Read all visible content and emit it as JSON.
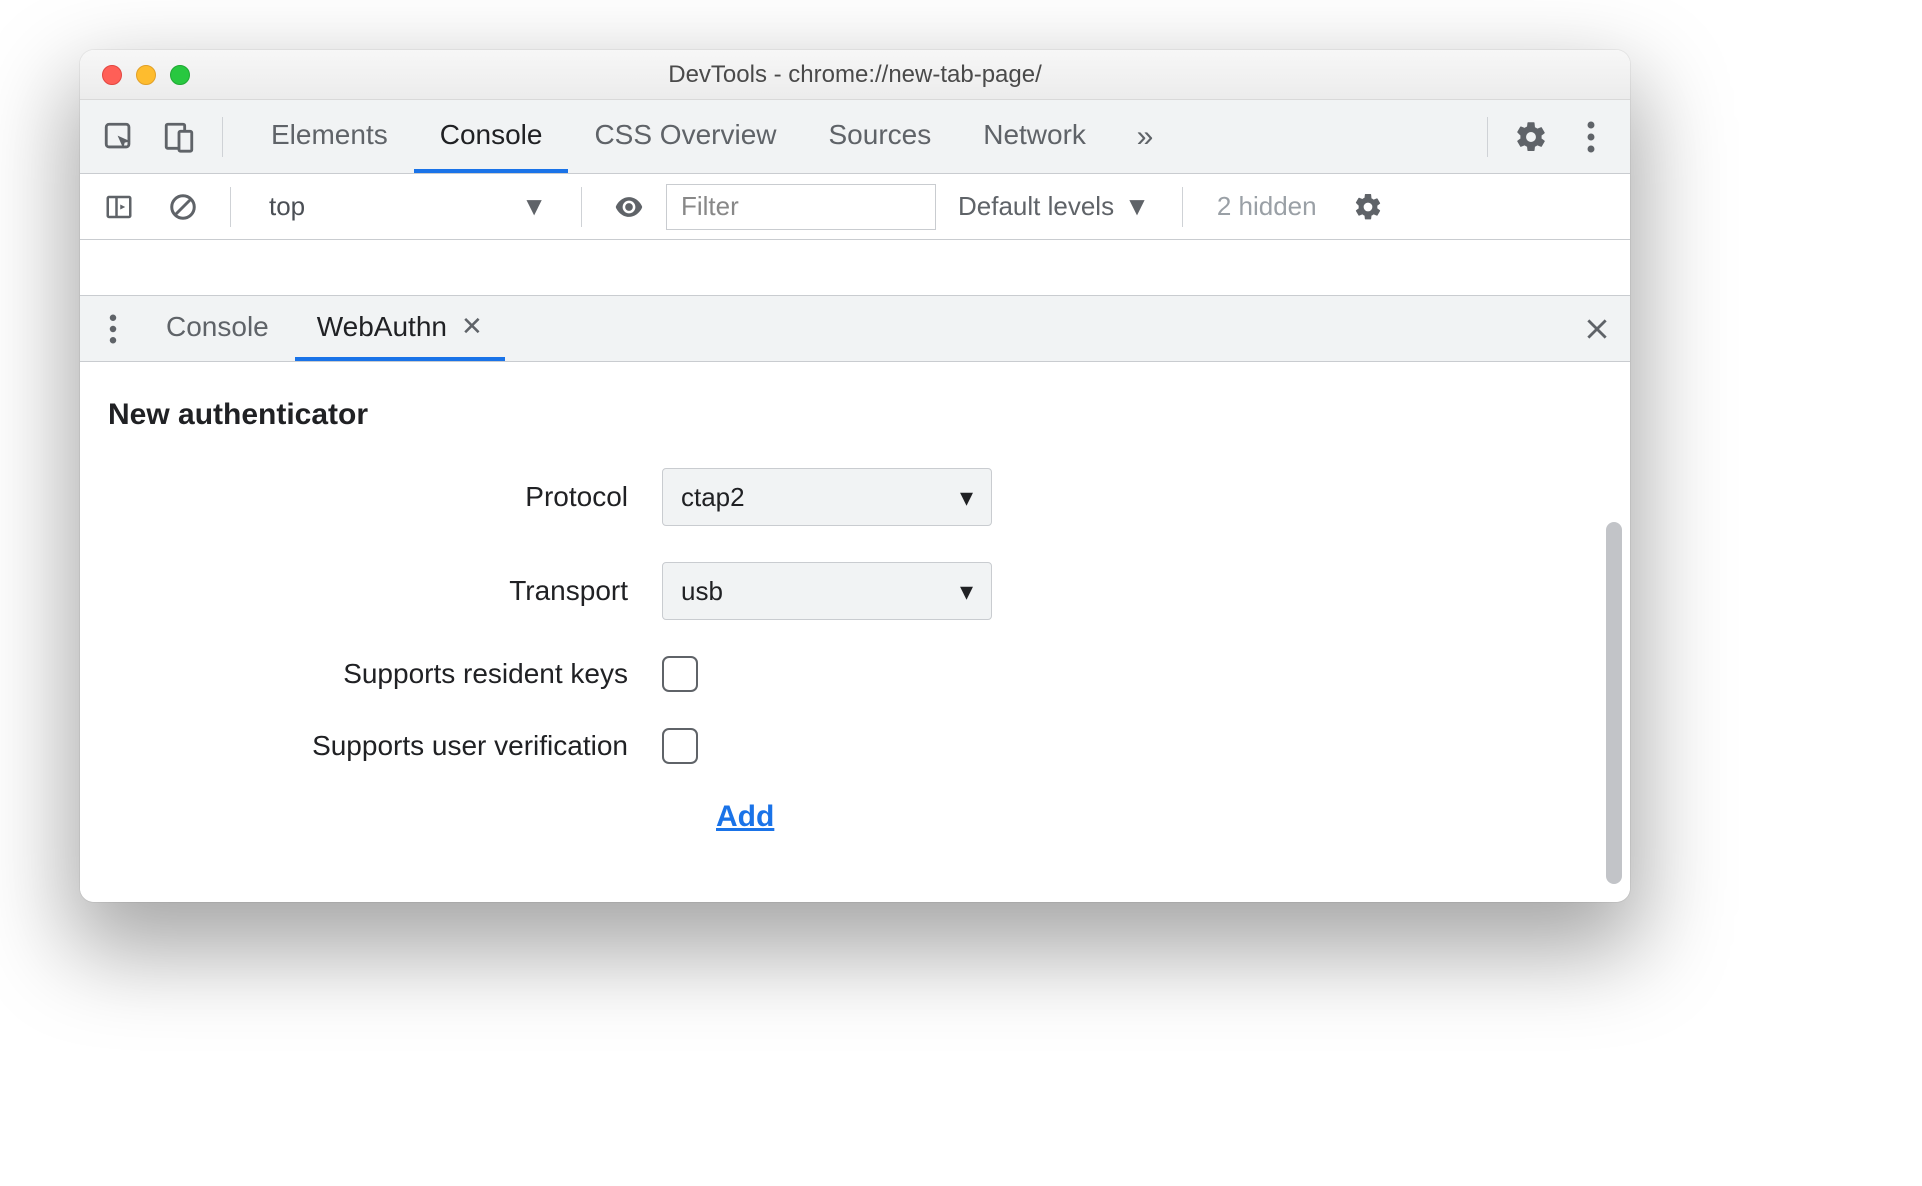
{
  "window": {
    "title": "DevTools - chrome://new-tab-page/"
  },
  "mainTabs": {
    "items": [
      "Elements",
      "Console",
      "CSS Overview",
      "Sources",
      "Network"
    ],
    "overflow": "»",
    "activeIndex": 1
  },
  "consoleBar": {
    "context": "top",
    "filterPlaceholder": "Filter",
    "levels": "Default levels",
    "hidden": "2 hidden"
  },
  "drawerTabs": {
    "items": [
      "Console",
      "WebAuthn"
    ],
    "activeIndex": 1
  },
  "webauthn": {
    "heading": "New authenticator",
    "labels": {
      "protocol": "Protocol",
      "transport": "Transport",
      "residentKeys": "Supports resident keys",
      "userVerification": "Supports user verification"
    },
    "values": {
      "protocol": "ctap2",
      "transport": "usb",
      "residentKeys": false,
      "userVerification": false
    },
    "addLabel": "Add"
  }
}
